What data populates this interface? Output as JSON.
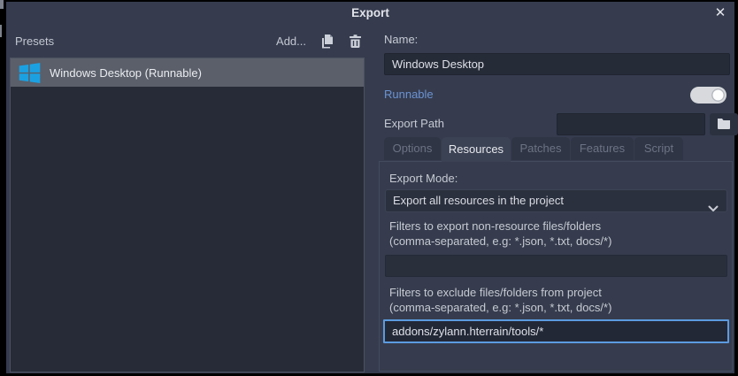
{
  "window": {
    "title": "Export",
    "close_glyph": "✕"
  },
  "presets_panel": {
    "header": "Presets",
    "add_label": "Add...",
    "items": [
      {
        "label": "Windows Desktop (Runnable)",
        "selected": true,
        "icon": "windows-logo-icon"
      }
    ]
  },
  "details_panel": {
    "name_label": "Name:",
    "name_value": "Windows Desktop",
    "runnable_label": "Runnable",
    "runnable_enabled": true,
    "export_path_label": "Export Path",
    "export_path_value": "",
    "tabs": [
      {
        "label": "Options",
        "active": false
      },
      {
        "label": "Resources",
        "active": true
      },
      {
        "label": "Patches",
        "active": false
      },
      {
        "label": "Features",
        "active": false
      },
      {
        "label": "Script",
        "active": false
      }
    ],
    "resources_tab": {
      "export_mode_label": "Export Mode:",
      "export_mode_value": "Export all resources in the project",
      "export_filter_label": "Filters to export non-resource files/folders",
      "export_filter_hint": "(comma-separated, e.g: *.json, *.txt, docs/*)",
      "export_filter_value": "",
      "exclude_filter_label": "Filters to exclude files/folders from project",
      "exclude_filter_hint": "(comma-separated, e.g: *.json, *.txt, docs/*)",
      "exclude_filter_value": "addons/zylann.hterrain/tools/*"
    }
  },
  "colors": {
    "accent_blue": "#6b93d3",
    "windows_blue": "#1ba1e2",
    "selection_gray": "#5a5f6a",
    "focus_border": "#5b9be0",
    "toggle_on": "#d7d9dd",
    "dialog_bg": "#363c4e",
    "list_bg": "#262b37"
  }
}
